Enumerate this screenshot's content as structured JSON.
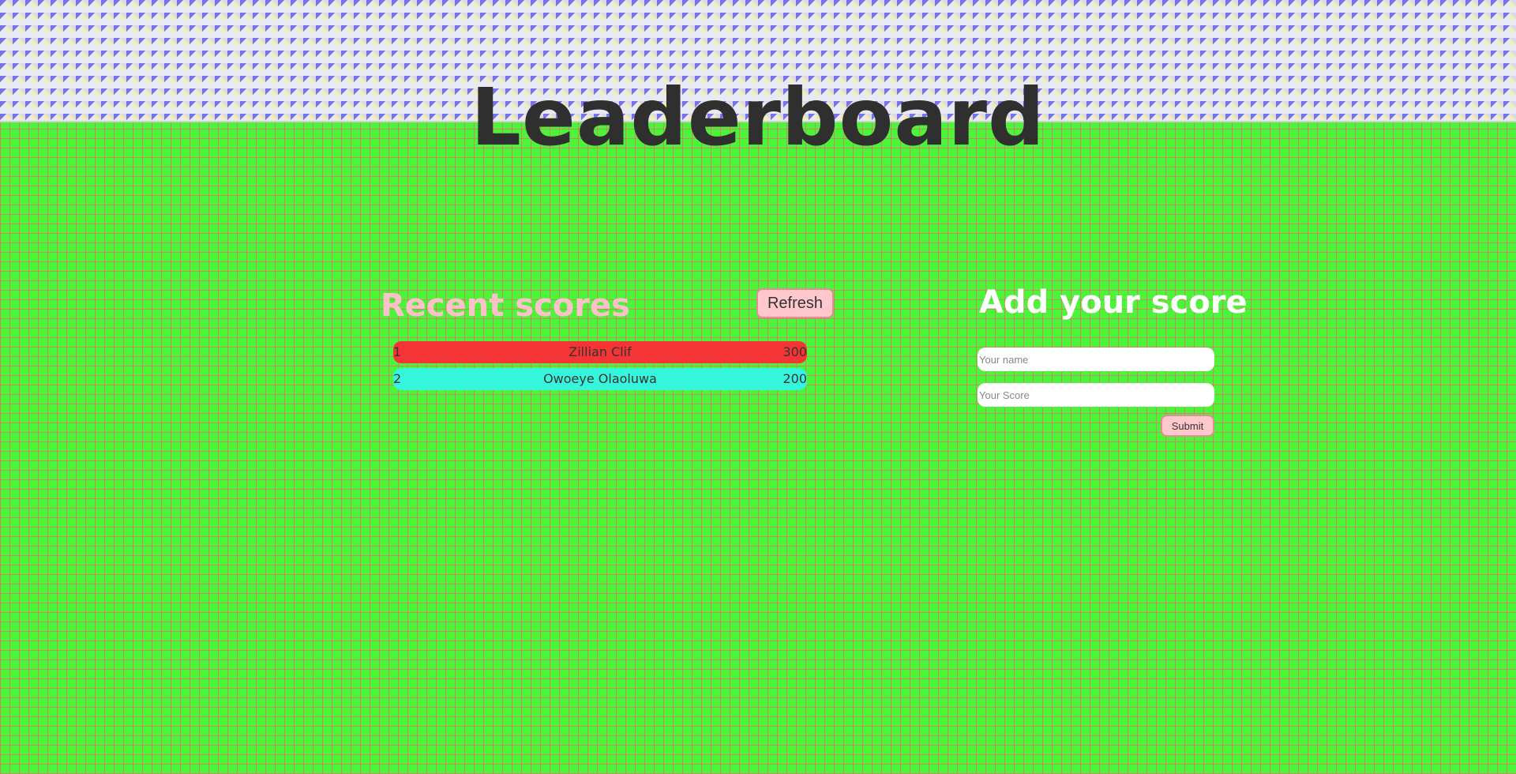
{
  "header": {
    "title": "Leaderboard"
  },
  "recent": {
    "title": "Recent scores",
    "refresh_label": "Refresh",
    "scores": [
      {
        "rank": "1",
        "name": "Zillian Clif",
        "score": "300",
        "color": "#f53535"
      },
      {
        "rank": "2",
        "name": "Owoeye Olaoluwa",
        "score": "200",
        "color": "#35f5dc"
      }
    ]
  },
  "add": {
    "title": "Add your score",
    "name_placeholder": "Your name",
    "score_placeholder": "Your Score",
    "submit_label": "Submit"
  }
}
